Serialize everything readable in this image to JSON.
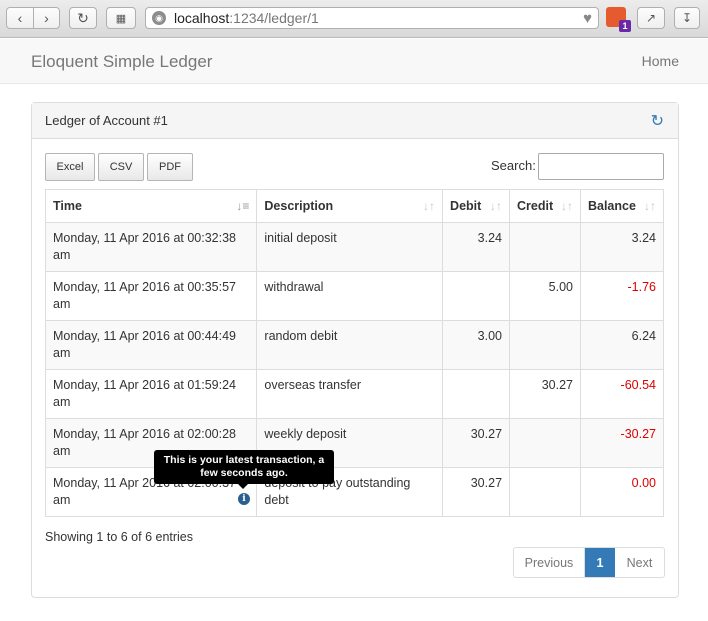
{
  "browser": {
    "url_host": "localhost",
    "url_rest": ":1234/ledger/1",
    "back_icon": "chevron-left-icon",
    "forward_icon": "chevron-right-icon",
    "extension_badge_count": "1"
  },
  "navbar": {
    "brand": "Eloquent Simple Ledger",
    "home": "Home"
  },
  "panel": {
    "title": "Ledger of Account #1"
  },
  "export": {
    "excel": "Excel",
    "csv": "CSV",
    "pdf": "PDF"
  },
  "search": {
    "label": "Search:",
    "value": ""
  },
  "table": {
    "columns": [
      "Time",
      "Description",
      "Debit",
      "Credit",
      "Balance"
    ],
    "rows": [
      {
        "time": "Monday, 11 Apr 2016 at 00:32:38 am",
        "description": "initial deposit",
        "debit": "3.24",
        "credit": "",
        "balance": "3.24"
      },
      {
        "time": "Monday, 11 Apr 2016 at 00:35:57 am",
        "description": "withdrawal",
        "debit": "",
        "credit": "5.00",
        "balance": "-1.76"
      },
      {
        "time": "Monday, 11 Apr 2016 at 00:44:49 am",
        "description": "random debit",
        "debit": "3.00",
        "credit": "",
        "balance": "6.24"
      },
      {
        "time": "Monday, 11 Apr 2016 at 01:59:24 am",
        "description": "overseas transfer",
        "debit": "",
        "credit": "30.27",
        "balance": "-60.54"
      },
      {
        "time": "Monday, 11 Apr 2016 at 02:00:28 am",
        "description": "weekly deposit",
        "debit": "30.27",
        "credit": "",
        "balance": "-30.27"
      },
      {
        "time": "Monday, 11 Apr 2016 at 02:00:37 am",
        "description": "deposit to pay outstanding debt",
        "debit": "30.27",
        "credit": "",
        "balance": "0.00"
      }
    ]
  },
  "tooltip": {
    "text": "This is your latest transaction, a few seconds ago."
  },
  "footer": {
    "info": "Showing 1 to 6 of 6 entries",
    "previous": "Previous",
    "current_page": "1",
    "next": "Next"
  },
  "colors": {
    "negative": "#dd0000",
    "accent": "#337ab7"
  }
}
